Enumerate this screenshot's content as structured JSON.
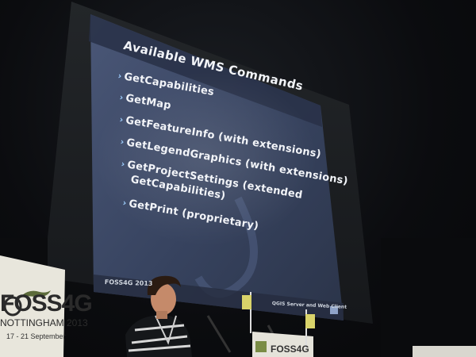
{
  "slide": {
    "title": "Available WMS Commands",
    "bullets": [
      "GetCapabilities",
      "GetMap",
      "GetFeatureInfo (with extensions)",
      "GetLegendGraphics (with extensions)",
      "GetProjectSettings (extended",
      "GetCapabilities)",
      "GetPrint (proprietary)"
    ],
    "footer_left": "FOSS4G 2013",
    "footer_right": "QGIS Server and Web Client"
  },
  "banner": {
    "brand": "FOSS4G",
    "city": "NOTTINGHAM 2013",
    "dates": "17 - 21 September"
  },
  "podium": {
    "brand": "FOSS4G"
  },
  "colors": {
    "slide_background": "#3a4560",
    "room": "#0d0f12",
    "banner_background": "#e8e6dc"
  }
}
